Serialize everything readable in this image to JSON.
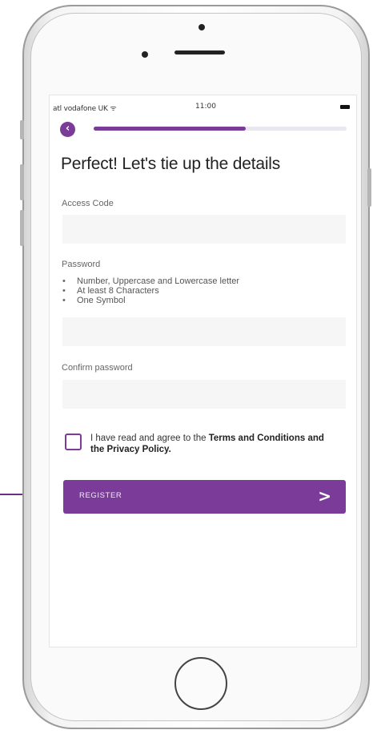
{
  "status_bar": {
    "carrier": "atl vodafone UK ᯤ",
    "time": "11:00"
  },
  "progress": {
    "fraction": 0.6
  },
  "title": "Perfect! Let's tie up the details",
  "access_code": {
    "label": "Access Code",
    "value": ""
  },
  "password": {
    "label": "Password",
    "rules": [
      "Number, Uppercase and Lowercase letter",
      "At least 8 Characters",
      "One Symbol"
    ],
    "value": ""
  },
  "confirm_password": {
    "label": "Confirm password",
    "value": ""
  },
  "agreement": {
    "prefix": "I have read and agree to the ",
    "terms": "Terms and Conditions",
    "middle": " and the ",
    "privacy": "Privacy Policy",
    "suffix": "."
  },
  "register_button": {
    "label": "REGISTER",
    "chevron": ">"
  },
  "colors": {
    "accent": "#7a3c98",
    "field_bg": "#f6f6f6"
  }
}
